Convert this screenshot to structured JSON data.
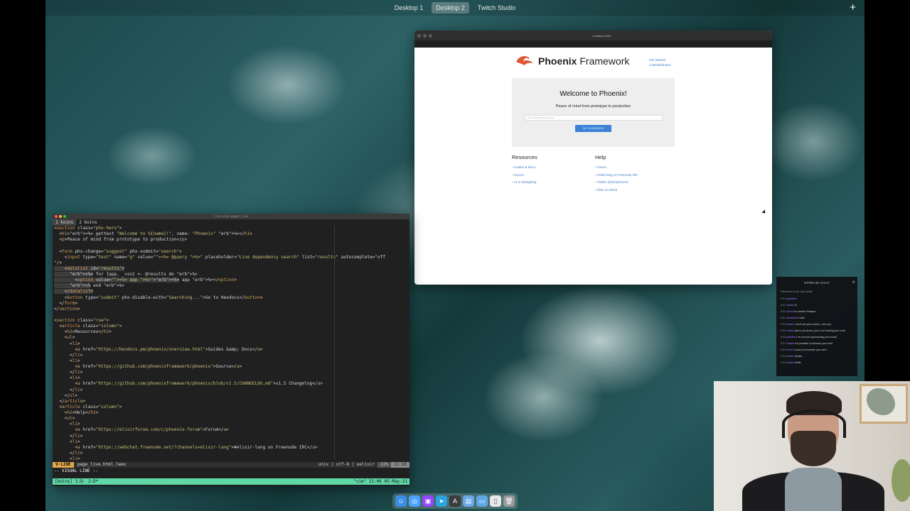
{
  "spaces": {
    "tabs": [
      "Desktop 1",
      "Desktop 2",
      "Twitch Studio"
    ],
    "active_index": 1,
    "add_label": "+"
  },
  "browser": {
    "url": "localhost:4000",
    "logo_text_bold": "Phoenix",
    "logo_text_rest": " Framework",
    "nav": [
      "Get Started",
      "LiveDashboard"
    ],
    "hero": {
      "title": "Welcome to Phoenix!",
      "subtitle": "Peace of mind from prototype to production",
      "search_placeholder": "Live dependency search",
      "button": "GO TO HEXDOCS"
    },
    "resources": {
      "heading": "Resources",
      "links": [
        "Guides & Docs",
        "Source",
        "v1.5 Changelog"
      ]
    },
    "help": {
      "heading": "Help",
      "links": [
        "Forum",
        "#elixir-lang on Freenode IRC",
        "Twitter @elixirphoenix",
        "Elixir on Slack"
      ]
    }
  },
  "terminal": {
    "window_title": "live_view_pages_live",
    "tmux_tabs": [
      "1 koins",
      "2 koins"
    ],
    "status_mode": "V-LINE",
    "status_file": "page_live.html.leex",
    "status_encoding": "unix | utf-8 | eelixir",
    "status_percent": "22%",
    "status_pos": "11:16",
    "command_line": "-- VISUAL LINE --",
    "tmux_left": "[koins] 1:D- 2:D*",
    "tmux_right": "\"vim\" 21:06 05-May-21"
  },
  "chat": {
    "title": "STREAM CHAT",
    "welcome": "Welcome to the chat room!",
    "messages": [
      {
        "time": "8:51",
        "user": "justsilvers",
        "text": ""
      },
      {
        "time": "8:51",
        "user": "moistin",
        "text": "hi"
      },
      {
        "time": "8:52",
        "user": "vinimn",
        "text": "is Leandro Nunique"
      },
      {
        "time": "8:52",
        "user": "nkowaltrust",
        "text": "hello"
      },
      {
        "time": "8:53",
        "user": "moistin",
        "text": "i don't see your screen, i see you"
      },
      {
        "time": "8:55",
        "user": "moistin",
        "text": "just to you know, you're not sharing your code"
      },
      {
        "time": "8:55",
        "user": "justsilvers",
        "text": "we are just approaching your board"
      },
      {
        "time": "8:57",
        "user": "moistin",
        "text": "it is possible to increase your font?"
      },
      {
        "time": "8:59",
        "user": "vinimn",
        "text": "Could you increase your font?"
      },
      {
        "time": "9:00",
        "user": "moistin",
        "text": "thanks"
      },
      {
        "time": "9:00",
        "user": "moistin",
        "text": "better"
      }
    ]
  },
  "dock": {
    "icons": [
      "finder-icon",
      "safari-icon",
      "twitch-icon",
      "telegram-icon",
      "alacritty-icon",
      "preview-icon",
      "folder-icon",
      "document-icon",
      "trash-icon"
    ]
  }
}
